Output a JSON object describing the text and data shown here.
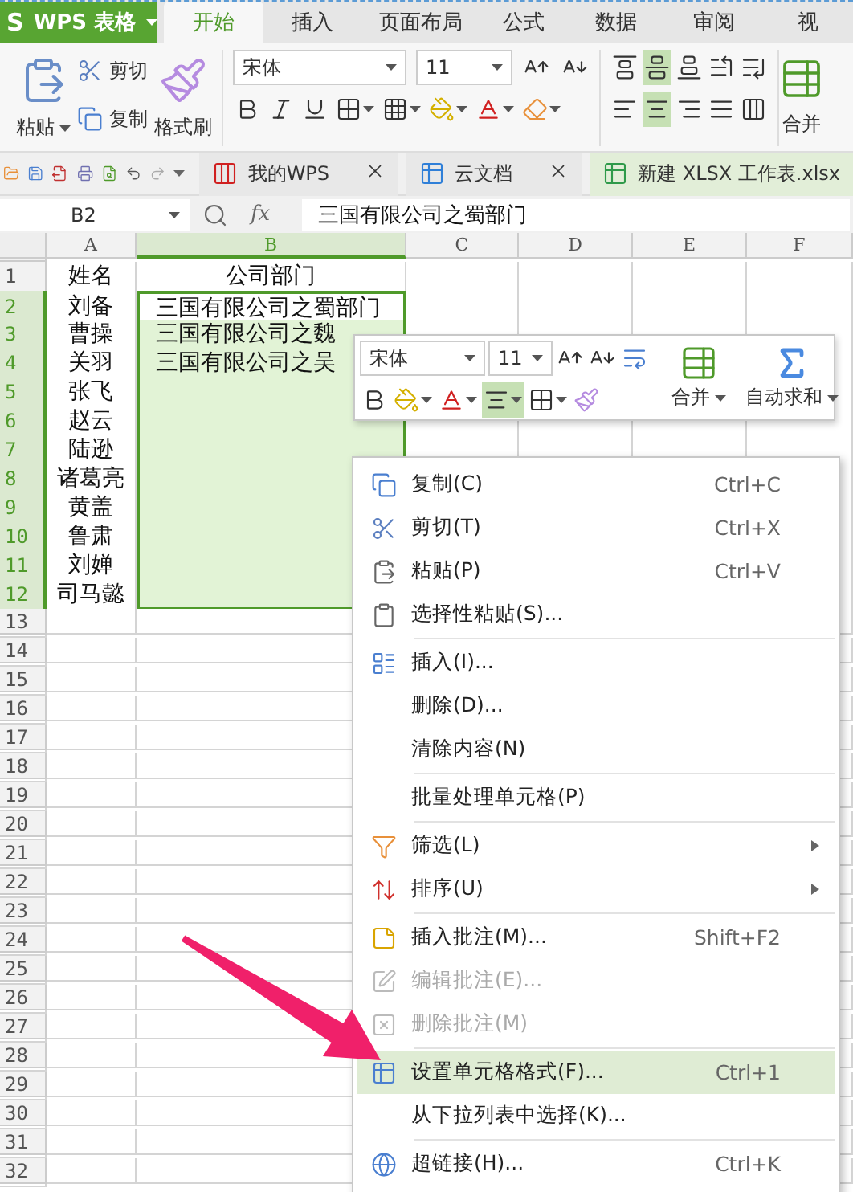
{
  "app": {
    "logo_mark": "S",
    "title": "WPS 表格"
  },
  "top_tabs": [
    {
      "label": "开始",
      "selected": true
    },
    {
      "label": "插入",
      "selected": false
    },
    {
      "label": "页面布局",
      "selected": false
    },
    {
      "label": "公式",
      "selected": false
    },
    {
      "label": "数据",
      "selected": false
    },
    {
      "label": "审阅",
      "selected": false
    },
    {
      "label": "视",
      "selected": false
    }
  ],
  "ribbon": {
    "paste": "粘贴",
    "cut": "剪切",
    "copy": "复制",
    "format_painter": "格式刷",
    "font": "宋体",
    "size": "11",
    "merge": "合并",
    "vertical_align": [
      {
        "selected": false
      },
      {
        "selected": true
      },
      {
        "selected": false
      }
    ],
    "horizontal_align": [
      {
        "selected": false
      },
      {
        "selected": true
      },
      {
        "selected": false
      },
      {
        "selected": false
      },
      {
        "selected": false
      }
    ]
  },
  "doc_tabs": [
    {
      "label": "我的WPS",
      "selected": false,
      "closable": true
    },
    {
      "label": "云文档",
      "selected": false,
      "closable": true
    },
    {
      "label": "新建 XLSX 工作表.xlsx",
      "selected": true,
      "closable": false
    }
  ],
  "formula_bar": {
    "cell": "B2",
    "fx": "fx",
    "value": "三国有限公司之蜀部门"
  },
  "sheet": {
    "columns": [
      {
        "label": "A",
        "selected": false
      },
      {
        "label": "B",
        "selected": true
      },
      {
        "label": "C",
        "selected": false
      },
      {
        "label": "D",
        "selected": false
      },
      {
        "label": "E",
        "selected": false
      },
      {
        "label": "F",
        "selected": false
      }
    ],
    "rows": [
      {
        "header": "1",
        "cells": [
          "姓名",
          "公司部门"
        ],
        "selected": false
      },
      {
        "header": "2",
        "cells": [
          "刘备",
          "三国有限公司之蜀部门"
        ],
        "selected": true
      },
      {
        "header": "3",
        "cells": [
          "曹操",
          "三国有限公司之魏"
        ],
        "selected": true
      },
      {
        "header": "4",
        "cells": [
          "关羽",
          "三国有限公司之吴"
        ],
        "selected": true
      },
      {
        "header": "5",
        "cells": [
          "张飞"
        ],
        "selected": true
      },
      {
        "header": "6",
        "cells": [
          "赵云"
        ],
        "selected": true
      },
      {
        "header": "7",
        "cells": [
          "陆逊"
        ],
        "selected": true
      },
      {
        "header": "8",
        "cells": [
          "诸葛亮"
        ],
        "selected": true
      },
      {
        "header": "9",
        "cells": [
          "黄盖"
        ],
        "selected": true
      },
      {
        "header": "10",
        "cells": [
          "鲁肃"
        ],
        "selected": true
      },
      {
        "header": "11",
        "cells": [
          "刘婵"
        ],
        "selected": true
      },
      {
        "header": "12",
        "cells": [
          "司马懿"
        ],
        "selected": true
      },
      {
        "header": "13",
        "selected": false
      },
      {
        "header": "14",
        "selected": false
      },
      {
        "header": "15",
        "selected": false
      },
      {
        "header": "16",
        "selected": false
      },
      {
        "header": "17",
        "selected": false
      },
      {
        "header": "18",
        "selected": false
      },
      {
        "header": "19",
        "selected": false
      },
      {
        "header": "20",
        "selected": false
      },
      {
        "header": "21",
        "selected": false
      },
      {
        "header": "22",
        "selected": false
      },
      {
        "header": "23",
        "selected": false
      },
      {
        "header": "24",
        "selected": false
      },
      {
        "header": "25",
        "selected": false
      },
      {
        "header": "26",
        "selected": false
      },
      {
        "header": "27",
        "selected": false
      },
      {
        "header": "28",
        "selected": false
      },
      {
        "header": "29",
        "selected": false
      },
      {
        "header": "30",
        "selected": false
      },
      {
        "header": "31",
        "selected": false
      },
      {
        "header": "32",
        "selected": false
      }
    ]
  },
  "mini_toolbar": {
    "font": "宋体",
    "size": "11",
    "align_selected": true,
    "merge": "合并",
    "autosum": "自动求和"
  },
  "context_menu": {
    "items": [
      {
        "kind": "item",
        "label": "复制(C)",
        "shortcut": "Ctrl+C",
        "disabled": false,
        "selected": false,
        "submenu": false
      },
      {
        "kind": "item",
        "label": "剪切(T)",
        "shortcut": "Ctrl+X",
        "disabled": false,
        "selected": false,
        "submenu": false
      },
      {
        "kind": "item",
        "label": "粘贴(P)",
        "shortcut": "Ctrl+V",
        "disabled": false,
        "selected": false,
        "submenu": false
      },
      {
        "kind": "item",
        "label": "选择性粘贴(S)...",
        "disabled": false,
        "selected": false,
        "submenu": false
      },
      {
        "kind": "separator"
      },
      {
        "kind": "item",
        "label": "插入(I)...",
        "disabled": false,
        "selected": false,
        "submenu": false
      },
      {
        "kind": "item",
        "label": "删除(D)...",
        "disabled": false,
        "selected": false,
        "submenu": false
      },
      {
        "kind": "item",
        "label": "清除内容(N)",
        "disabled": false,
        "selected": false,
        "submenu": false
      },
      {
        "kind": "separator"
      },
      {
        "kind": "item",
        "label": "批量处理单元格(P)",
        "disabled": false,
        "selected": false,
        "submenu": false
      },
      {
        "kind": "separator"
      },
      {
        "kind": "item",
        "label": "筛选(L)",
        "disabled": false,
        "selected": false,
        "submenu": true
      },
      {
        "kind": "item",
        "label": "排序(U)",
        "disabled": false,
        "selected": false,
        "submenu": true
      },
      {
        "kind": "separator"
      },
      {
        "kind": "item",
        "label": "插入批注(M)...",
        "shortcut": "Shift+F2",
        "disabled": false,
        "selected": false,
        "submenu": false
      },
      {
        "kind": "item",
        "label": "编辑批注(E)...",
        "disabled": true,
        "selected": false,
        "submenu": false
      },
      {
        "kind": "item",
        "label": "删除批注(M)",
        "disabled": true,
        "selected": false,
        "submenu": false
      },
      {
        "kind": "separator"
      },
      {
        "kind": "item",
        "label": "设置单元格格式(F)...",
        "shortcut": "Ctrl+1",
        "disabled": false,
        "selected": true,
        "submenu": false
      },
      {
        "kind": "item",
        "label": "从下拉列表中选择(K)...",
        "disabled": false,
        "selected": false,
        "submenu": false
      },
      {
        "kind": "separator"
      },
      {
        "kind": "item",
        "label": "超链接(H)...",
        "shortcut": "Ctrl+K",
        "disabled": false,
        "selected": false,
        "submenu": false
      }
    ]
  }
}
